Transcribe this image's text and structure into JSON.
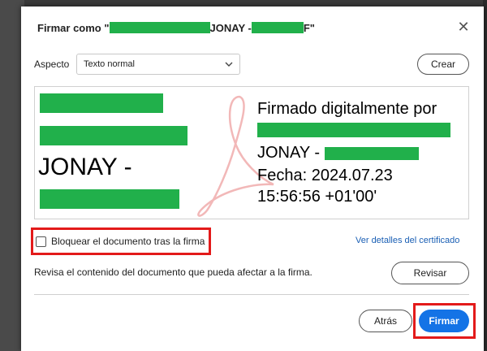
{
  "dialog": {
    "title_prefix": "Firmar como \"",
    "title_middle": " JONAY - ",
    "title_suffix": "F\"",
    "close_glyph": "✕"
  },
  "appearance": {
    "label": "Aspecto",
    "selected": "Texto normal",
    "create_label": "Crear"
  },
  "signature_preview": {
    "name_line": "JONAY -",
    "info_heading": "Firmado digitalmente por",
    "info_name": "JONAY - ",
    "date_line": "Fecha: 2024.07.23",
    "time_line": "15:56:56 +01'00'"
  },
  "options": {
    "lock_label": "Bloquear el documento tras la firma",
    "cert_link": "Ver detalles del certificado"
  },
  "review": {
    "text": "Revisa el contenido del documento que pueda afectar a la firma.",
    "button": "Revisar"
  },
  "footer": {
    "back": "Atrás",
    "sign": "Firmar"
  },
  "colors": {
    "redaction": "#21b04b",
    "primary": "#1473e6",
    "highlight": "#e31a1a",
    "link": "#1a5fb4"
  }
}
